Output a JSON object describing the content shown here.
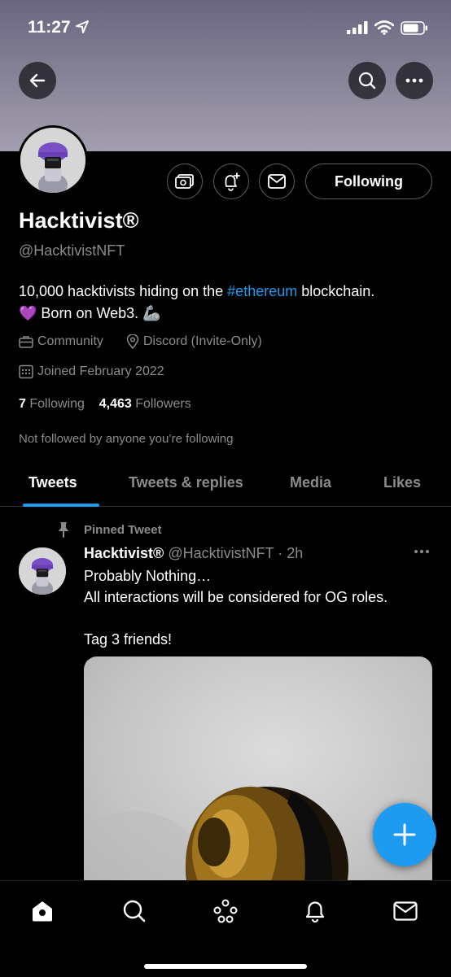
{
  "status_bar": {
    "time": "11:27"
  },
  "header": {},
  "profile": {
    "name": "Hacktivist®",
    "handle": "@HacktivistNFT",
    "bio_part1": "10,000 hacktivists hiding on the ",
    "bio_hashtag": "#ethereum",
    "bio_part2": " blockchain.",
    "bio_line2_emoji": "💜",
    "bio_line2": " Born on Web3. ",
    "bio_line2_emoji2": "🦾",
    "category": "Community",
    "location": "Discord (Invite-Only)",
    "joined": "Joined February 2022",
    "following_count": "7",
    "following_label": "Following",
    "followers_count": "4,463",
    "followers_label": "Followers",
    "not_followed_text": "Not followed by anyone you’re following",
    "follow_button_label": "Following"
  },
  "tabs": [
    {
      "label": "Tweets",
      "active": true
    },
    {
      "label": "Tweets & replies",
      "active": false
    },
    {
      "label": "Media",
      "active": false
    },
    {
      "label": "Likes",
      "active": false
    }
  ],
  "pinned_tweet": {
    "pin_label": "Pinned Tweet",
    "author_name": "Hacktivist®",
    "author_meta": "@HacktivistNFT · 2h",
    "text": "Probably Nothing…\nAll interactions will be considered for OG roles.\n\nTag 3 friends!"
  },
  "colors": {
    "accent": "#1d9bf0",
    "muted": "#8b8b8b",
    "background": "#000000"
  },
  "icons": {
    "back": "arrow-left-icon",
    "search": "search-icon",
    "more": "more-icon",
    "tip": "tip-jar-icon",
    "notify": "bell-plus-icon",
    "message": "envelope-icon",
    "fab": "compose-plus-icon"
  }
}
